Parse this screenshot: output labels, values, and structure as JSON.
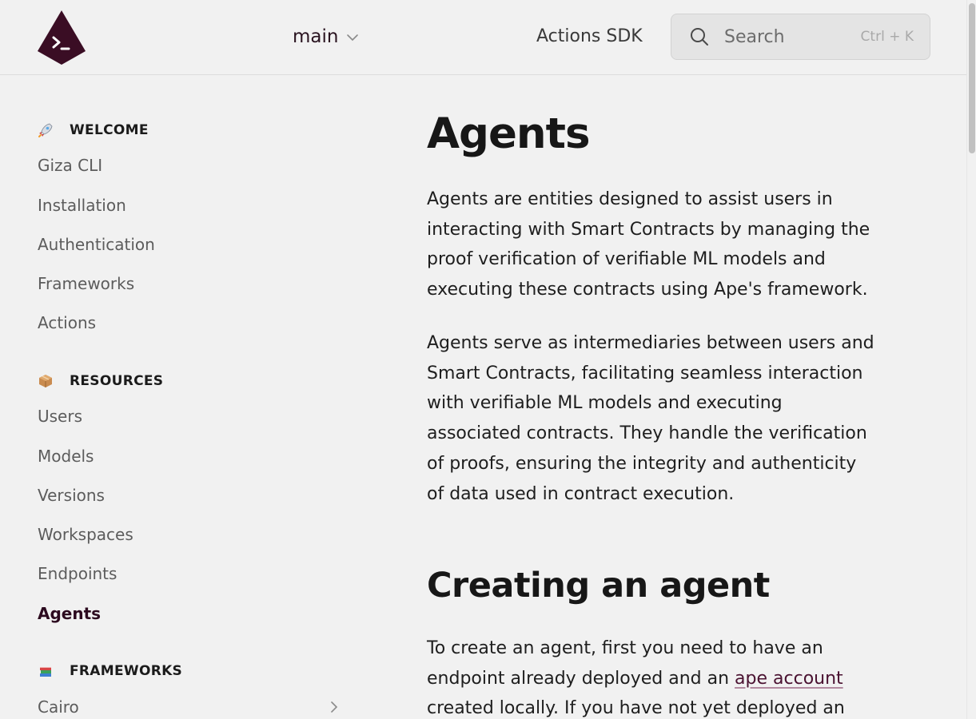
{
  "header": {
    "branch_label": "main",
    "nav_link": "Actions SDK",
    "search_placeholder": "Search",
    "search_shortcut": "Ctrl + K"
  },
  "sidebar": {
    "sections": [
      {
        "title": "WELCOME",
        "icon": "rocket-icon",
        "items": [
          "Giza CLI",
          "Installation",
          "Authentication",
          "Frameworks",
          "Actions"
        ]
      },
      {
        "title": "RESOURCES",
        "icon": "package-icon",
        "items": [
          "Users",
          "Models",
          "Versions",
          "Workspaces",
          "Endpoints",
          "Agents"
        ]
      },
      {
        "title": "FRAMEWORKS",
        "icon": "books-icon",
        "items": [
          "Cairo"
        ]
      }
    ],
    "active_item": "Agents"
  },
  "main": {
    "title": "Agents",
    "paragraph1": "Agents are entities designed to assist users in interacting with Smart Contracts by managing the proof verification of verifiable ML models and executing these contracts using Ape's framework.",
    "paragraph2": "Agents serve as intermediaries between users and Smart Contracts, facilitating seamless interaction with verifiable ML models and executing associated contracts. They handle the verification of proofs, ensuring the integrity and authenticity of data used in contract execution.",
    "section_heading": "Creating an agent",
    "paragraph3_before": "To create an agent, first you need to have an endpoint already deployed and an ",
    "paragraph3_link": "ape account",
    "paragraph3_after": " created locally. If you have not yet deployed an"
  },
  "colors": {
    "background": "#f1f1f1",
    "brand": "#3a0d24",
    "text": "#1b1b1b",
    "muted": "#5c5c5c"
  }
}
